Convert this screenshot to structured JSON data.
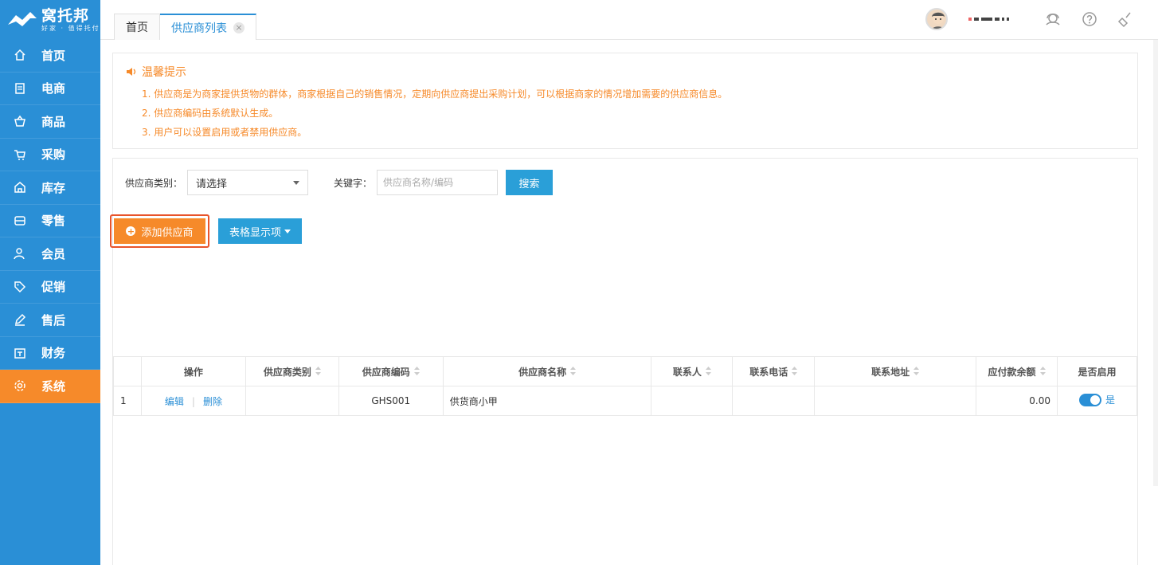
{
  "logo": {
    "brand": "窝托邦",
    "slogan": "好家 · 值得托付"
  },
  "sidebar": {
    "items": [
      {
        "label": "首页",
        "icon": "home-icon"
      },
      {
        "label": "电商",
        "icon": "document-icon"
      },
      {
        "label": "商品",
        "icon": "basket-icon"
      },
      {
        "label": "采购",
        "icon": "cart-icon"
      },
      {
        "label": "库存",
        "icon": "warehouse-icon"
      },
      {
        "label": "零售",
        "icon": "store-icon"
      },
      {
        "label": "会员",
        "icon": "member-icon"
      },
      {
        "label": "促销",
        "icon": "tag-icon"
      },
      {
        "label": "售后",
        "icon": "pen-icon"
      },
      {
        "label": "财务",
        "icon": "finance-icon"
      },
      {
        "label": "系统",
        "icon": "gear-icon",
        "active": true
      }
    ]
  },
  "tabs": [
    {
      "label": "首页"
    },
    {
      "label": "供应商列表",
      "active": true,
      "close": "×"
    }
  ],
  "tips": {
    "title": "温馨提示",
    "items": [
      "1. 供应商是为商家提供货物的群体，商家根据自己的销售情况，定期向供应商提出采购计划，可以根据商家的情况增加需要的供应商信息。",
      "2. 供应商编码由系统默认生成。",
      "3. 用户可以设置启用或者禁用供应商。"
    ]
  },
  "filters": {
    "category_label": "供应商类别：",
    "category_value": "请选择",
    "keyword_label": "关键字：",
    "keyword_placeholder": "供应商名称/编码",
    "search_label": "搜索"
  },
  "actions": {
    "add_label": "添加供应商",
    "add_icon": "+",
    "columns_label": "表格显示项"
  },
  "table": {
    "headers": [
      "操作",
      "供应商类别",
      "供应商编码",
      "供应商名称",
      "联系人",
      "联系电话",
      "联系地址",
      "应付款余额",
      "是否启用"
    ],
    "rows": [
      {
        "index": "1",
        "edit": "编辑",
        "divider": "|",
        "delete": "删除",
        "category": "",
        "code": "GHS001",
        "name": "供货商小甲",
        "contact": "",
        "phone": "",
        "address": "",
        "balance": "0.00",
        "enabled": "是"
      }
    ]
  },
  "colors": {
    "primary": "#2a8fd6",
    "accent": "#f68a2a",
    "highlight_border": "#e8542b"
  }
}
